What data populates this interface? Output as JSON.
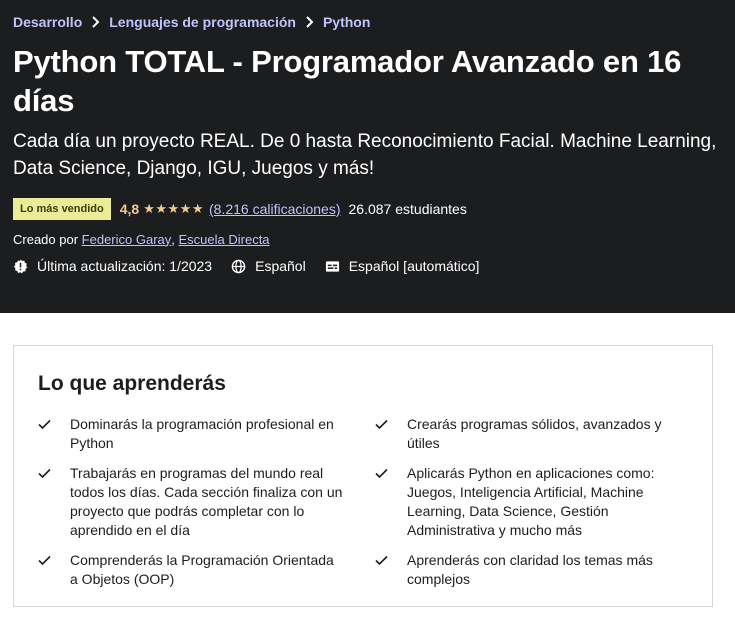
{
  "breadcrumb": [
    "Desarrollo",
    "Lenguajes de programación",
    "Python"
  ],
  "course": {
    "title": "Python TOTAL - Programador Avanzado en 16 días",
    "subtitle": "Cada día un proyecto REAL. De 0 hasta Reconocimiento Facial. Machine Learning, Data Science, Django, IGU, Juegos y más!",
    "badge": "Lo más vendido",
    "rating": "4,8",
    "stars": "★★★★★",
    "ratings_count": "(8.216 calificaciones)",
    "students": "26.087 estudiantes",
    "created_by_label": "Creado por",
    "authors": [
      "Federico Garay",
      "Escuela Directa"
    ],
    "last_update": "Última actualización: 1/2023",
    "language": "Español",
    "captions": "Español [automático]"
  },
  "learn": {
    "title": "Lo que aprenderás",
    "left": [
      "Dominarás la programación profesional en Python",
      "Trabajarás en programas del mundo real todos los días. Cada sección finaliza con un proyecto que podrás completar con lo aprendido en el día",
      "Comprenderás la Programación Orientada a Objetos (OOP)"
    ],
    "right": [
      "Crearás programas sólidos, avanzados y útiles",
      "Aplicarás Python en aplicaciones como: Juegos, Inteligencia Artificial, Machine Learning, Data Science, Gestión Administrativa y mucho más",
      "Aprenderás con claridad los temas más complejos"
    ]
  },
  "colors": {
    "hero_bg": "#1c1d1f",
    "link": "#c0c4fc",
    "rating": "#f3ca8c",
    "badge_bg": "#eceb98"
  }
}
